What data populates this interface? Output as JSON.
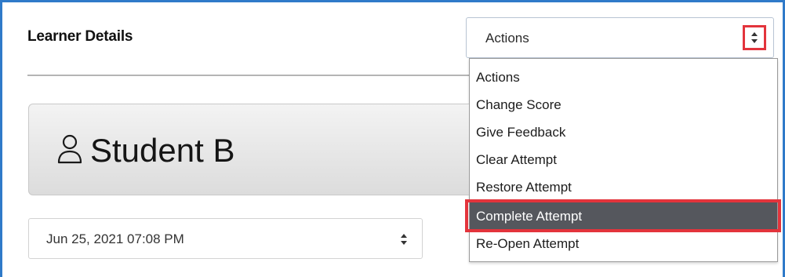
{
  "panel": {
    "title": "Learner Details"
  },
  "actions_select": {
    "selected_value": "Actions",
    "arrow_icon": "up-down-arrows-icon"
  },
  "actions_dropdown": {
    "options": [
      {
        "label": "Actions"
      },
      {
        "label": "Change Score"
      },
      {
        "label": "Give Feedback"
      },
      {
        "label": "Clear Attempt"
      },
      {
        "label": "Restore Attempt"
      },
      {
        "label": "Complete Attempt"
      },
      {
        "label": "Re-Open Attempt"
      }
    ],
    "highlighted_index": 5
  },
  "student": {
    "name": "Student B",
    "icon": "user-icon"
  },
  "attempt_select": {
    "selected_value": "Jun 25, 2021 07:08 PM",
    "arrow_icon": "up-down-arrows-icon"
  },
  "colors": {
    "frame_border": "#2f7ac9",
    "highlight_red": "#e3343c",
    "option_selected_bg": "#55575d"
  }
}
